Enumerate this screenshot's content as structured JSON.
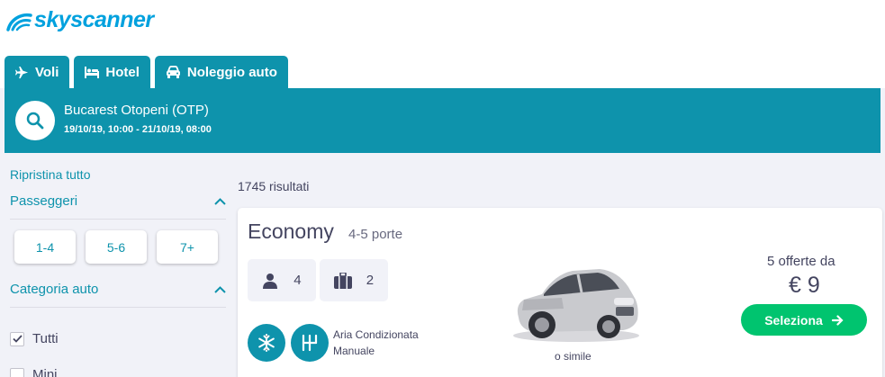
{
  "brand": {
    "name": "skyscanner"
  },
  "tabs": [
    {
      "label": "Voli",
      "icon": "plane-icon"
    },
    {
      "label": "Hotel",
      "icon": "bed-icon"
    },
    {
      "label": "Noleggio auto",
      "icon": "car-icon"
    }
  ],
  "search": {
    "location": "Bucarest Otopeni (OTP)",
    "dates": "19/10/19, 10:00 - 21/10/19, 08:00"
  },
  "sidebar": {
    "reset": "Ripristina tutto",
    "passengers": {
      "title": "Passeggeri",
      "options": [
        "1-4",
        "5-6",
        "7+"
      ]
    },
    "category": {
      "title": "Categoria auto",
      "options": [
        {
          "label": "Tutti",
          "checked": true
        },
        {
          "label": "Mini",
          "checked": false
        }
      ]
    }
  },
  "results": {
    "count": "1745 risultati"
  },
  "card": {
    "class": "Economy",
    "doors": "4-5 porte",
    "seats": "4",
    "bags": "2",
    "features": [
      "Aria Condizionata",
      "Manuale"
    ],
    "similar": "o simile",
    "offers": "5 offerte da",
    "price": "€ 9",
    "cta": "Seleziona"
  },
  "colors": {
    "accent": "#0e93ac",
    "cta": "#00c46f",
    "logo": "#00a1de"
  }
}
